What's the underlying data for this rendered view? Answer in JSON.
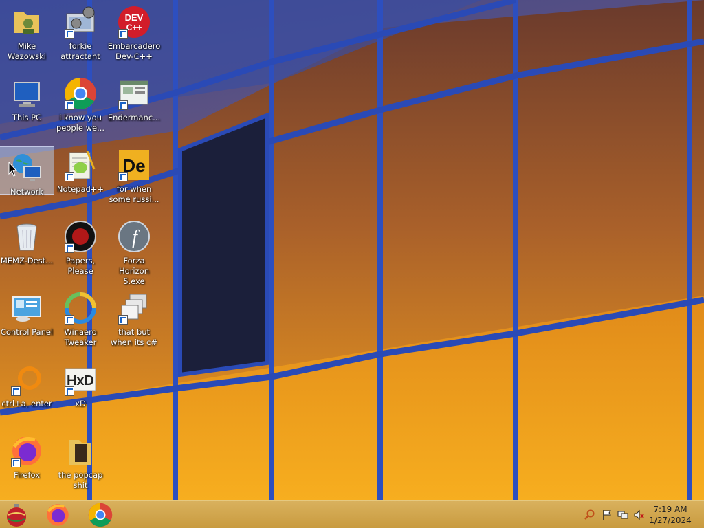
{
  "desktop_icons": [
    {
      "label": "Mike Wazowski",
      "icon": "folder-user-icon"
    },
    {
      "label": "forkie attractant",
      "icon": "settings-monitor-icon"
    },
    {
      "label": "Embarcadero Dev-C++",
      "icon": "devcpp-icon"
    },
    {
      "label": "This PC",
      "icon": "computer-icon"
    },
    {
      "label": "i know you people we...",
      "icon": "chrome-icon"
    },
    {
      "label": "Endermanc...",
      "icon": "app-window-icon"
    },
    {
      "label": "Network",
      "icon": "network-icon"
    },
    {
      "label": "Notepad++",
      "icon": "notepadpp-icon"
    },
    {
      "label": "for when some russi...",
      "icon": "de-icon"
    },
    {
      "label": "MEMZ-Dest...",
      "icon": "recycle-bin-icon"
    },
    {
      "label": "Papers, Please",
      "icon": "papers-please-icon"
    },
    {
      "label": "Forza Horizon 5.exe",
      "icon": "flash-icon"
    },
    {
      "label": "Control Panel",
      "icon": "control-panel-icon"
    },
    {
      "label": "Winaero Tweaker",
      "icon": "winaero-icon"
    },
    {
      "label": "that but when its c#",
      "icon": "windows-stack-icon"
    },
    {
      "label": "ctrl+a, enter",
      "icon": "orange-ring-icon"
    },
    {
      "label": "xD",
      "icon": "hxd-icon"
    },
    {
      "label": "Firefox",
      "icon": "firefox-icon"
    },
    {
      "label": "the popcap shit",
      "icon": "folder-icon"
    }
  ],
  "selected_icon": "Network",
  "taskbar": {
    "pinned": [
      "ornament-start-icon",
      "firefox-icon",
      "chrome-icon"
    ],
    "tray": [
      "search-icon",
      "flag-icon",
      "network-tray-icon",
      "volume-muted-icon"
    ],
    "time": "7:19 AM",
    "date": "1/27/2024"
  },
  "colors": {
    "taskbar": "#d0a44b",
    "selection": "#b4c8e6",
    "wall_orange": "#f5a21c",
    "frame_blue": "#2b4fb8"
  }
}
